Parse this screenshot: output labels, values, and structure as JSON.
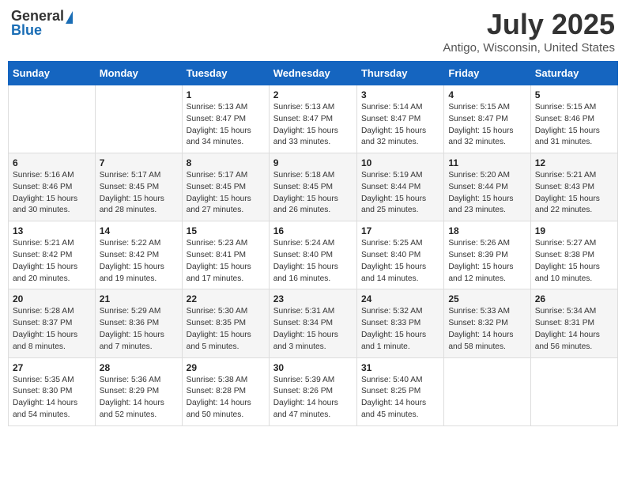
{
  "logo": {
    "general": "General",
    "blue": "Blue"
  },
  "title": "July 2025",
  "location": "Antigo, Wisconsin, United States",
  "days_of_week": [
    "Sunday",
    "Monday",
    "Tuesday",
    "Wednesday",
    "Thursday",
    "Friday",
    "Saturday"
  ],
  "weeks": [
    [
      {
        "day": "",
        "sunrise": "",
        "sunset": "",
        "daylight": ""
      },
      {
        "day": "",
        "sunrise": "",
        "sunset": "",
        "daylight": ""
      },
      {
        "day": "1",
        "sunrise": "Sunrise: 5:13 AM",
        "sunset": "Sunset: 8:47 PM",
        "daylight": "Daylight: 15 hours and 34 minutes."
      },
      {
        "day": "2",
        "sunrise": "Sunrise: 5:13 AM",
        "sunset": "Sunset: 8:47 PM",
        "daylight": "Daylight: 15 hours and 33 minutes."
      },
      {
        "day": "3",
        "sunrise": "Sunrise: 5:14 AM",
        "sunset": "Sunset: 8:47 PM",
        "daylight": "Daylight: 15 hours and 32 minutes."
      },
      {
        "day": "4",
        "sunrise": "Sunrise: 5:15 AM",
        "sunset": "Sunset: 8:47 PM",
        "daylight": "Daylight: 15 hours and 32 minutes."
      },
      {
        "day": "5",
        "sunrise": "Sunrise: 5:15 AM",
        "sunset": "Sunset: 8:46 PM",
        "daylight": "Daylight: 15 hours and 31 minutes."
      }
    ],
    [
      {
        "day": "6",
        "sunrise": "Sunrise: 5:16 AM",
        "sunset": "Sunset: 8:46 PM",
        "daylight": "Daylight: 15 hours and 30 minutes."
      },
      {
        "day": "7",
        "sunrise": "Sunrise: 5:17 AM",
        "sunset": "Sunset: 8:45 PM",
        "daylight": "Daylight: 15 hours and 28 minutes."
      },
      {
        "day": "8",
        "sunrise": "Sunrise: 5:17 AM",
        "sunset": "Sunset: 8:45 PM",
        "daylight": "Daylight: 15 hours and 27 minutes."
      },
      {
        "day": "9",
        "sunrise": "Sunrise: 5:18 AM",
        "sunset": "Sunset: 8:45 PM",
        "daylight": "Daylight: 15 hours and 26 minutes."
      },
      {
        "day": "10",
        "sunrise": "Sunrise: 5:19 AM",
        "sunset": "Sunset: 8:44 PM",
        "daylight": "Daylight: 15 hours and 25 minutes."
      },
      {
        "day": "11",
        "sunrise": "Sunrise: 5:20 AM",
        "sunset": "Sunset: 8:44 PM",
        "daylight": "Daylight: 15 hours and 23 minutes."
      },
      {
        "day": "12",
        "sunrise": "Sunrise: 5:21 AM",
        "sunset": "Sunset: 8:43 PM",
        "daylight": "Daylight: 15 hours and 22 minutes."
      }
    ],
    [
      {
        "day": "13",
        "sunrise": "Sunrise: 5:21 AM",
        "sunset": "Sunset: 8:42 PM",
        "daylight": "Daylight: 15 hours and 20 minutes."
      },
      {
        "day": "14",
        "sunrise": "Sunrise: 5:22 AM",
        "sunset": "Sunset: 8:42 PM",
        "daylight": "Daylight: 15 hours and 19 minutes."
      },
      {
        "day": "15",
        "sunrise": "Sunrise: 5:23 AM",
        "sunset": "Sunset: 8:41 PM",
        "daylight": "Daylight: 15 hours and 17 minutes."
      },
      {
        "day": "16",
        "sunrise": "Sunrise: 5:24 AM",
        "sunset": "Sunset: 8:40 PM",
        "daylight": "Daylight: 15 hours and 16 minutes."
      },
      {
        "day": "17",
        "sunrise": "Sunrise: 5:25 AM",
        "sunset": "Sunset: 8:40 PM",
        "daylight": "Daylight: 15 hours and 14 minutes."
      },
      {
        "day": "18",
        "sunrise": "Sunrise: 5:26 AM",
        "sunset": "Sunset: 8:39 PM",
        "daylight": "Daylight: 15 hours and 12 minutes."
      },
      {
        "day": "19",
        "sunrise": "Sunrise: 5:27 AM",
        "sunset": "Sunset: 8:38 PM",
        "daylight": "Daylight: 15 hours and 10 minutes."
      }
    ],
    [
      {
        "day": "20",
        "sunrise": "Sunrise: 5:28 AM",
        "sunset": "Sunset: 8:37 PM",
        "daylight": "Daylight: 15 hours and 8 minutes."
      },
      {
        "day": "21",
        "sunrise": "Sunrise: 5:29 AM",
        "sunset": "Sunset: 8:36 PM",
        "daylight": "Daylight: 15 hours and 7 minutes."
      },
      {
        "day": "22",
        "sunrise": "Sunrise: 5:30 AM",
        "sunset": "Sunset: 8:35 PM",
        "daylight": "Daylight: 15 hours and 5 minutes."
      },
      {
        "day": "23",
        "sunrise": "Sunrise: 5:31 AM",
        "sunset": "Sunset: 8:34 PM",
        "daylight": "Daylight: 15 hours and 3 minutes."
      },
      {
        "day": "24",
        "sunrise": "Sunrise: 5:32 AM",
        "sunset": "Sunset: 8:33 PM",
        "daylight": "Daylight: 15 hours and 1 minute."
      },
      {
        "day": "25",
        "sunrise": "Sunrise: 5:33 AM",
        "sunset": "Sunset: 8:32 PM",
        "daylight": "Daylight: 14 hours and 58 minutes."
      },
      {
        "day": "26",
        "sunrise": "Sunrise: 5:34 AM",
        "sunset": "Sunset: 8:31 PM",
        "daylight": "Daylight: 14 hours and 56 minutes."
      }
    ],
    [
      {
        "day": "27",
        "sunrise": "Sunrise: 5:35 AM",
        "sunset": "Sunset: 8:30 PM",
        "daylight": "Daylight: 14 hours and 54 minutes."
      },
      {
        "day": "28",
        "sunrise": "Sunrise: 5:36 AM",
        "sunset": "Sunset: 8:29 PM",
        "daylight": "Daylight: 14 hours and 52 minutes."
      },
      {
        "day": "29",
        "sunrise": "Sunrise: 5:38 AM",
        "sunset": "Sunset: 8:28 PM",
        "daylight": "Daylight: 14 hours and 50 minutes."
      },
      {
        "day": "30",
        "sunrise": "Sunrise: 5:39 AM",
        "sunset": "Sunset: 8:26 PM",
        "daylight": "Daylight: 14 hours and 47 minutes."
      },
      {
        "day": "31",
        "sunrise": "Sunrise: 5:40 AM",
        "sunset": "Sunset: 8:25 PM",
        "daylight": "Daylight: 14 hours and 45 minutes."
      },
      {
        "day": "",
        "sunrise": "",
        "sunset": "",
        "daylight": ""
      },
      {
        "day": "",
        "sunrise": "",
        "sunset": "",
        "daylight": ""
      }
    ]
  ]
}
